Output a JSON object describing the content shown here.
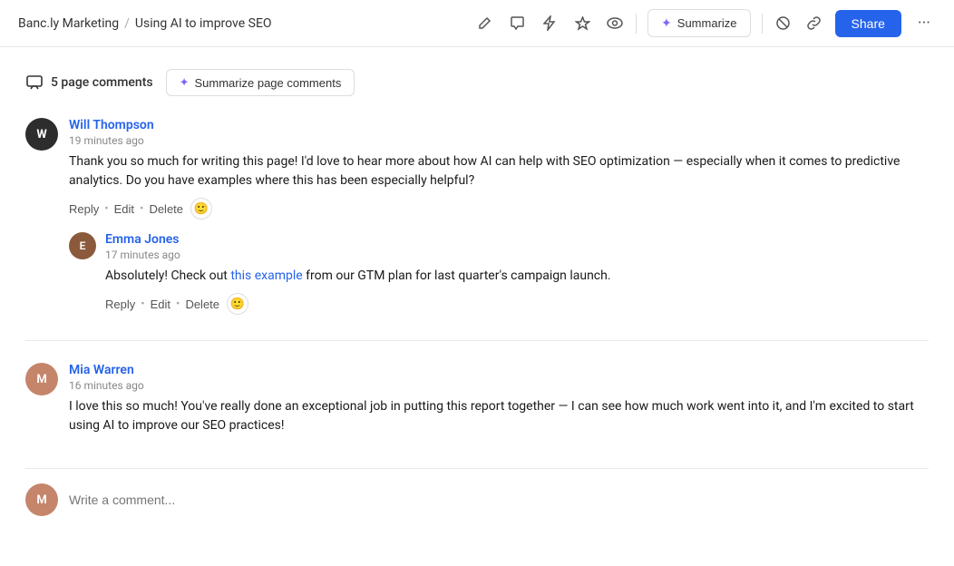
{
  "header": {
    "breadcrumb_root": "Banc.ly Marketing",
    "breadcrumb_separator": "/",
    "breadcrumb_current": "Using AI to improve SEO",
    "summarize_label": "Summarize",
    "share_label": "Share",
    "icons": {
      "edit": "✏",
      "comment": "💬",
      "bolt": "⚡",
      "star": "☆",
      "eye": "◉",
      "no": "🚫",
      "link": "🔗",
      "more": "···"
    }
  },
  "comments_panel": {
    "count_label": "5 page comments",
    "summarize_btn_label": "Summarize page comments"
  },
  "comments": [
    {
      "id": "will",
      "author": "Will Thompson",
      "time": "19 minutes ago",
      "text": "Thank you so much for writing this page! I'd love to hear more about how AI can help with SEO optimization — especially when it comes to predictive analytics. Do you have examples where this has been especially helpful?",
      "avatar_initials": "W",
      "avatar_class": "will-avatar",
      "actions": [
        "Reply",
        "Edit",
        "Delete"
      ],
      "replies": [
        {
          "id": "emma",
          "author": "Emma Jones",
          "time": "17 minutes ago",
          "text_before_link": "Absolutely! Check out ",
          "link_text": "this example",
          "text_after_link": " from our GTM plan for last quarter's campaign launch.",
          "avatar_initials": "E",
          "avatar_class": "emma-avatar",
          "actions": [
            "Reply",
            "Edit",
            "Delete"
          ]
        }
      ]
    },
    {
      "id": "mia",
      "author": "Mia Warren",
      "time": "16 minutes ago",
      "text": "I love this so much! You've really done an exceptional job in putting this report together — I can see how much work went into it, and I'm excited to start using AI to improve our SEO practices!",
      "avatar_initials": "M",
      "avatar_class": "mia-avatar",
      "actions": []
    }
  ],
  "write_comment": {
    "placeholder": "Write a comment...",
    "avatar_initials": "M",
    "avatar_class": "bottom-avatar"
  }
}
